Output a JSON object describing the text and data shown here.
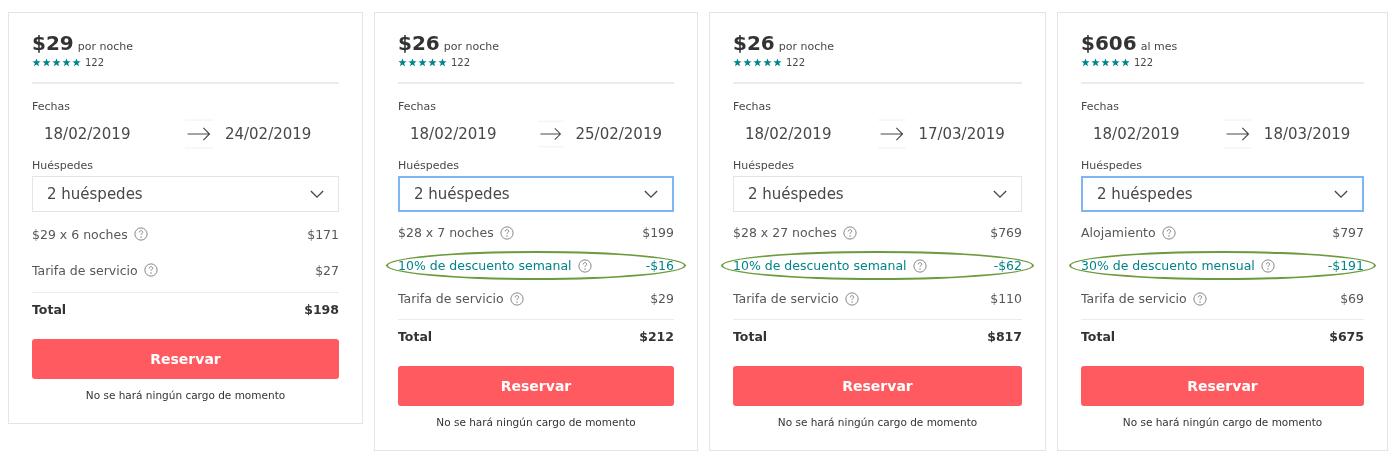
{
  "panels": [
    {
      "price": "$29",
      "unit": "por noche",
      "stars": 5,
      "reviews": "122",
      "dates_label": "Fechas",
      "check_in": "18/02/2019",
      "check_out": "24/02/2019",
      "guests_label": "Huéspedes",
      "guests": {
        "value": "2 huéspedes",
        "focused": false
      },
      "lines": [
        {
          "kind": "charge",
          "label": "$29 x 6 noches",
          "amount": "$171"
        },
        {
          "kind": "charge",
          "label": "Tarifa de servicio",
          "amount": "$27"
        }
      ],
      "total_label": "Total",
      "total": "$198",
      "button": "Reservar",
      "note": "No se hará ningún cargo de momento"
    },
    {
      "price": "$26",
      "unit": "por noche",
      "stars": 5,
      "reviews": "122",
      "dates_label": "Fechas",
      "check_in": "18/02/2019",
      "check_out": "25/02/2019",
      "guests_label": "Huéspedes",
      "guests": {
        "value": "2 huéspedes",
        "focused": true
      },
      "lines": [
        {
          "kind": "charge",
          "label": "$28 x 7 noches",
          "amount": "$199"
        },
        {
          "kind": "discount",
          "label": "10% de descuento semanal",
          "amount": "-$16"
        },
        {
          "kind": "charge",
          "label": "Tarifa de servicio",
          "amount": "$29"
        }
      ],
      "total_label": "Total",
      "total": "$212",
      "button": "Reservar",
      "note": "No se hará ningún cargo de momento"
    },
    {
      "price": "$26",
      "unit": "por noche",
      "stars": 5,
      "reviews": "122",
      "dates_label": "Fechas",
      "check_in": "18/02/2019",
      "check_out": "17/03/2019",
      "guests_label": "Huéspedes",
      "guests": {
        "value": "2 huéspedes",
        "focused": false
      },
      "lines": [
        {
          "kind": "charge",
          "label": "$28 x 27 noches",
          "amount": "$769"
        },
        {
          "kind": "discount",
          "label": "10% de descuento semanal",
          "amount": "-$62"
        },
        {
          "kind": "charge",
          "label": "Tarifa de servicio",
          "amount": "$110"
        }
      ],
      "total_label": "Total",
      "total": "$817",
      "button": "Reservar",
      "note": "No se hará ningún cargo de momento"
    },
    {
      "price": "$606",
      "unit": "al mes",
      "stars": 5,
      "reviews": "122",
      "dates_label": "Fechas",
      "check_in": "18/02/2019",
      "check_out": "18/03/2019",
      "guests_label": "Huéspedes",
      "guests": {
        "value": "2 huéspedes",
        "focused": true
      },
      "lines": [
        {
          "kind": "charge",
          "label": "Alojamiento",
          "amount": "$797"
        },
        {
          "kind": "discount",
          "label": "30% de descuento mensual",
          "amount": "-$191"
        },
        {
          "kind": "charge",
          "label": "Tarifa de servicio",
          "amount": "$69"
        }
      ],
      "total_label": "Total",
      "total": "$675",
      "button": "Reservar",
      "note": "No se hará ningún cargo de momento"
    }
  ]
}
